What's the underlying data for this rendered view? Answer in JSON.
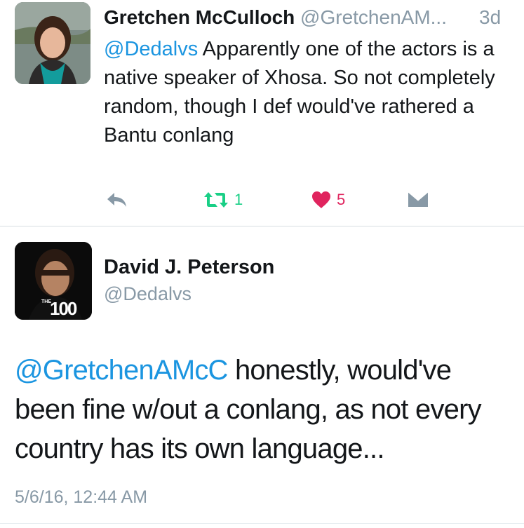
{
  "tweet1": {
    "author_name": "Gretchen McCulloch",
    "author_handle": "@GretchenAM...",
    "time_ago": "3d",
    "mention": "@Dedalvs",
    "text": " Apparently one of the actors is a native speaker of Xhosa. So not completely random, though I def would've rathered a Bantu conlang",
    "actions": {
      "reply_icon": "reply-icon",
      "retweet_icon": "retweet-icon",
      "retweet_count": "1",
      "like_icon": "heart-icon",
      "like_count": "5",
      "dm_icon": "envelope-icon"
    }
  },
  "tweet2": {
    "author_name": "David J. Peterson",
    "author_handle": "@Dedalvs",
    "avatar_badge_small": "THE",
    "avatar_badge": "100",
    "mention": "@GretchenAMcC",
    "text": " honestly, would've been fine w/out a conlang, as not every country has its own language...",
    "timestamp": "5/6/16, 12:44 AM"
  },
  "colors": {
    "link": "#1b95e0",
    "muted": "#8899a6",
    "retweet": "#19cf86",
    "like": "#e0245e",
    "text": "#14171a"
  }
}
